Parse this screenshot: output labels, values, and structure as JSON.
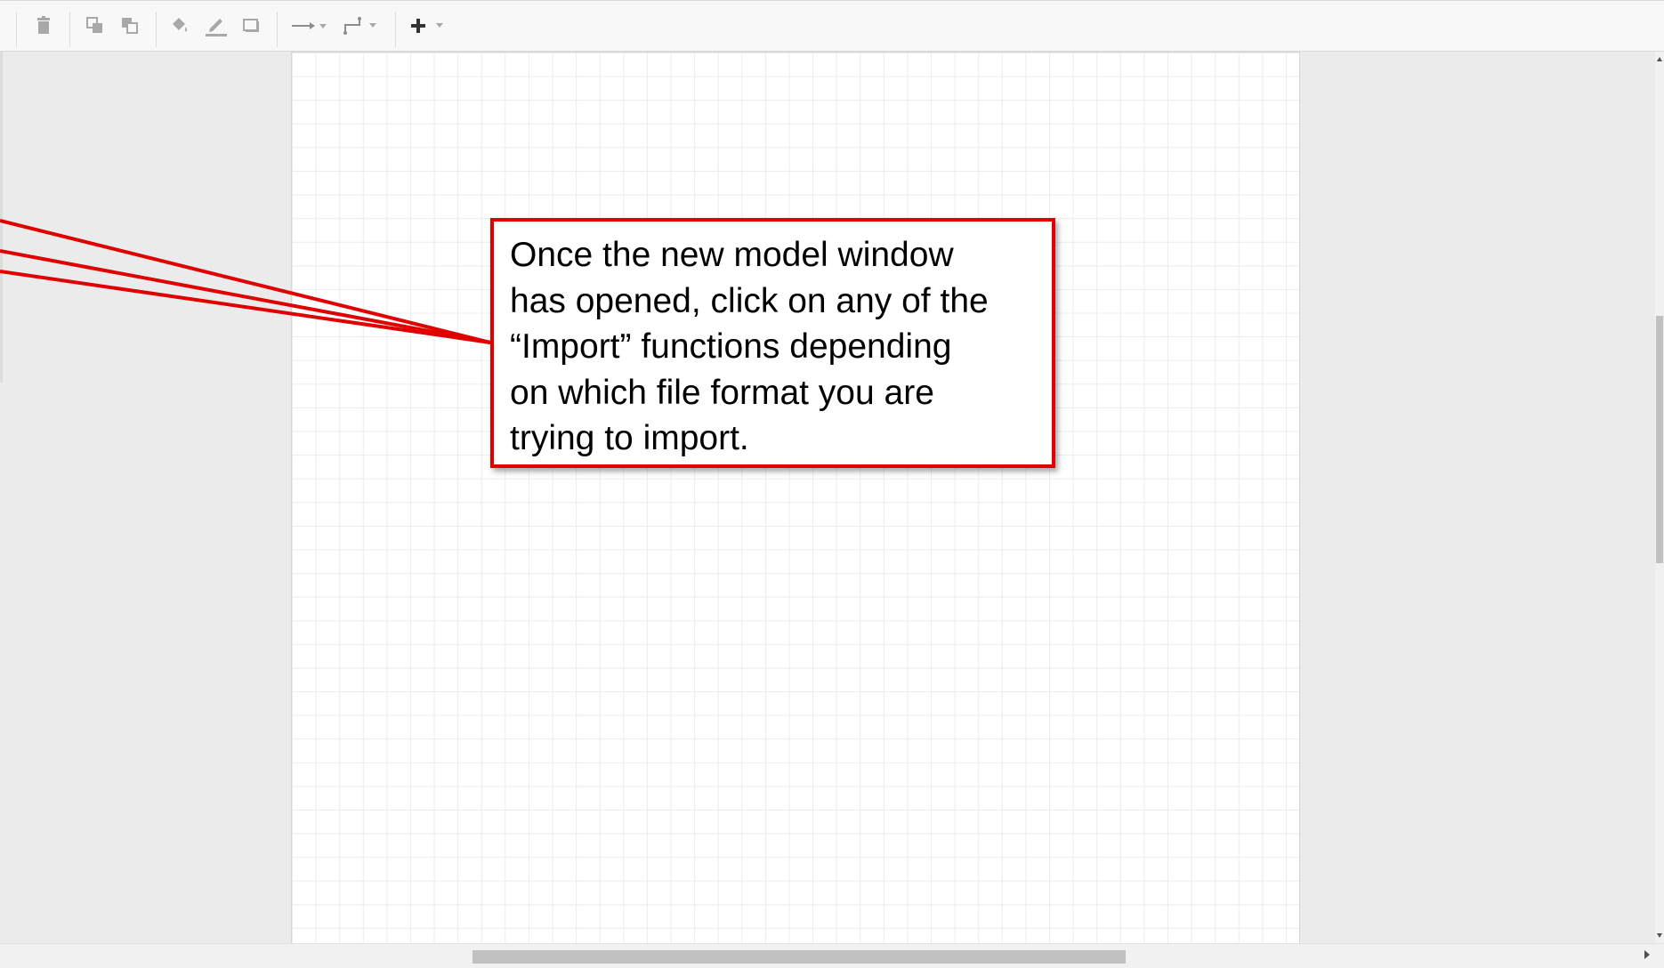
{
  "toolbar": {
    "icons": [
      "delete-icon",
      "to-front-icon",
      "to-back-icon",
      "fill-color-icon",
      "line-color-icon",
      "shadow-icon",
      "connection-arrow-icon",
      "waypoints-icon",
      "insert-plus-icon"
    ],
    "icon_color": "#9a9a9a",
    "insert_color": "#333333"
  },
  "callout": {
    "lines": [
      "Once the new model window",
      "has opened, click on any of the",
      "“Import” functions depending",
      "on which file format you are",
      "trying to import."
    ],
    "border_color": "#e00000"
  }
}
